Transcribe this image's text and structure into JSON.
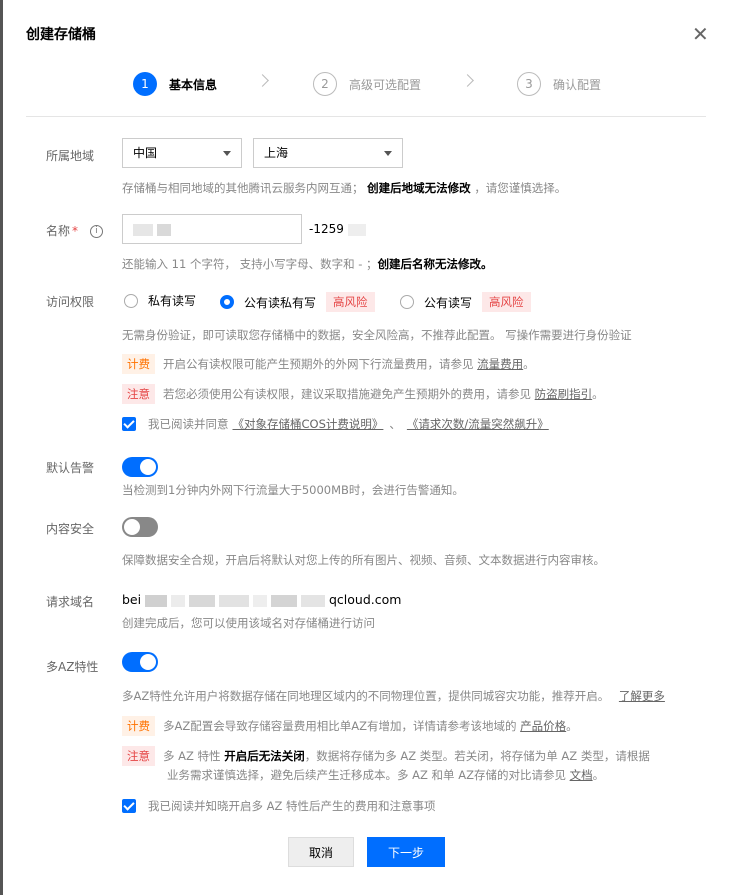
{
  "dialog": {
    "title": "创建存储桶",
    "close_glyph": "✕"
  },
  "steps": [
    {
      "num": "1",
      "label": "基本信息"
    },
    {
      "num": "2",
      "label": "高级可选配置"
    },
    {
      "num": "3",
      "label": "确认配置"
    }
  ],
  "region": {
    "label": "所属地域",
    "country": "中国",
    "city": "上海",
    "help_pre": "存储桶与相同地域的其他腾讯云服务内网互通；",
    "help_bold": "创建后地域无法修改",
    "help_post": "，请您谨慎选择。"
  },
  "name": {
    "label": "名称",
    "required_mark": "*",
    "info_glyph": "i",
    "suffix": "-1259",
    "help_pre": "还能输入 11 个字符， 支持小写字母、数字和 - ；",
    "help_bold": "创建后名称无法修改。"
  },
  "access": {
    "label": "访问权限",
    "options": [
      {
        "label": "私有读写"
      },
      {
        "label": "公有读私有写",
        "risk": "高风险"
      },
      {
        "label": "公有读写",
        "risk": "高风险"
      }
    ],
    "desc": "无需身份验证，即可读取您存储桶中的数据，安全风险高，不推荐此配置。 写操作需要进行身份验证",
    "fee_tag": "计费",
    "fee_text": "开启公有读权限可能产生预期外的外网下行流量费用，请参见",
    "fee_link": "流量费用",
    "fee_end": "。",
    "note_tag": "注意",
    "note_text": "若您必须使用公有读权限，建议采取措施避免产生预期外的费用，请参见",
    "note_link": "防盗刷指引",
    "note_end": "。",
    "agree_pre": "我已阅读并同意",
    "agree_link1": "《对象存储桶COS计费说明》",
    "agree_sep": "、",
    "agree_link2": "《请求次数/流量突然飙升》"
  },
  "alarm": {
    "label": "默认告警",
    "help": "当检测到1分钟内外网下行流量大于5000MB时，会进行告警通知。"
  },
  "content_security": {
    "label": "内容安全",
    "help": "保障数据安全合规，开启后将默认对您上传的所有图片、视频、音频、文本数据进行内容审核。"
  },
  "request_domain": {
    "label": "请求域名",
    "prefix": "bei",
    "suffix": "qcloud.com",
    "help": "创建完成后，您可以使用该域名对存储桶进行访问"
  },
  "multi_az": {
    "label": "多AZ特性",
    "desc": "多AZ特性允许用户将数据存储在同地理区域内的不同物理位置，提供同城容灾功能，推荐开启。",
    "desc_link": "了解更多",
    "fee_tag": "计费",
    "fee_text": "多AZ配置会导致存储容量费用相比单AZ有增加，详情请参考该地域的",
    "fee_link": "产品价格",
    "fee_end": "。",
    "note_tag": "注意",
    "note_pre": "多 AZ 特性",
    "note_bold": "开启后无法关闭",
    "note_post": "，数据将存储为多 AZ 类型。若关闭，将存储为单 AZ 类型，请根据",
    "note_line2": "业务需求谨慎选择，避免后续产生迁移成本。多 AZ 和单 AZ存储的对比请参见",
    "note_link": "文档",
    "note_end": "。",
    "agree": "我已阅读并知晓开启多 AZ 特性后产生的费用和注意事项"
  },
  "footer": {
    "cancel": "取消",
    "next": "下一步"
  }
}
